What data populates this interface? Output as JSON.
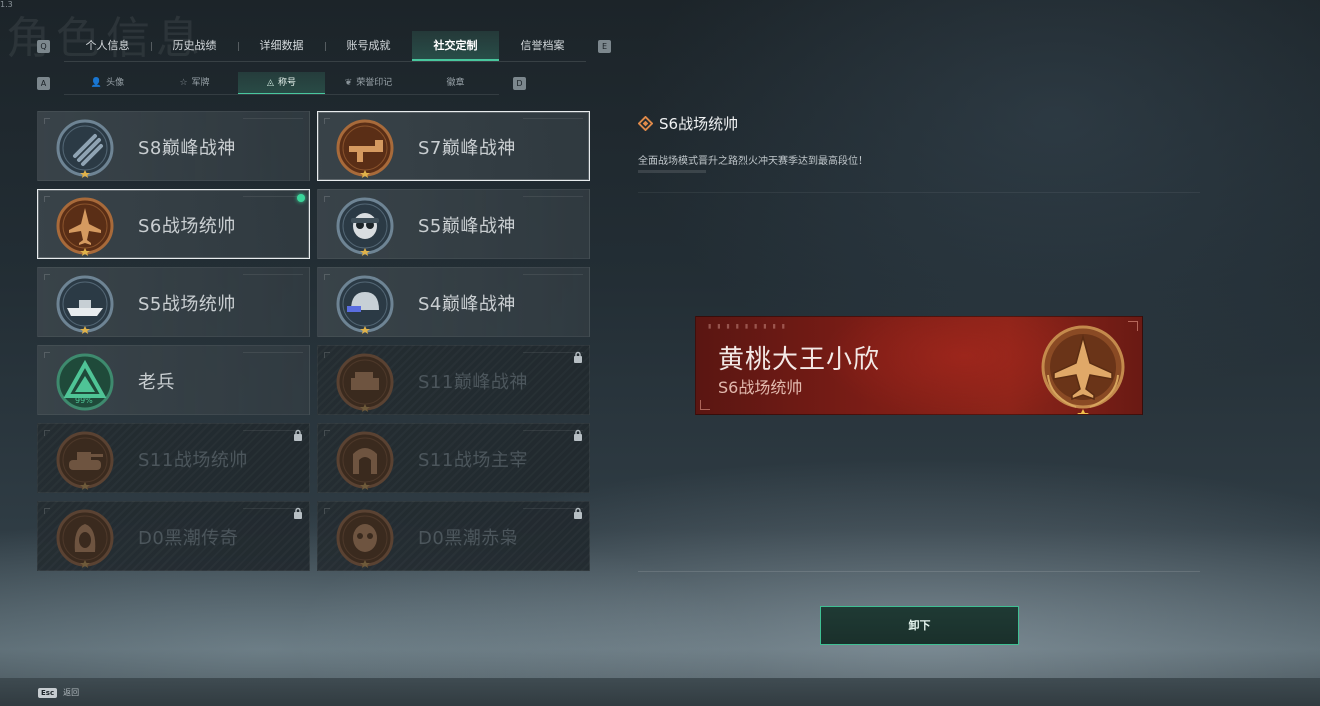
{
  "page": {
    "ghost_title": "角色信息",
    "version": "1.3"
  },
  "top_tabs": {
    "left_key": "Q",
    "right_key": "E",
    "items": [
      {
        "label": "个人信息",
        "active": false
      },
      {
        "label": "历史战绩",
        "active": false
      },
      {
        "label": "详细数据",
        "active": false
      },
      {
        "label": "账号成就",
        "active": false
      },
      {
        "label": "社交定制",
        "active": true
      },
      {
        "label": "信誉档案",
        "active": false
      }
    ]
  },
  "sub_tabs": {
    "left_key": "A",
    "right_key": "D",
    "items": [
      {
        "label": "头像",
        "icon": "person-icon",
        "glyph": "👤",
        "active": false
      },
      {
        "label": "军牌",
        "icon": "dogtag-icon",
        "glyph": "☆",
        "active": false
      },
      {
        "label": "称号",
        "icon": "rank-icon",
        "glyph": "◬",
        "active": true
      },
      {
        "label": "荣誉印记",
        "icon": "laurel-icon",
        "glyph": "❦",
        "active": false
      },
      {
        "label": "徽章",
        "icon": "badge-icon",
        "glyph": "",
        "active": false
      }
    ]
  },
  "titles": [
    {
      "name": "S8巅峰战神",
      "locked": false,
      "selected": false,
      "equipped": false,
      "emblem": "cross-emblem-icon",
      "tone": "silver"
    },
    {
      "name": "S7巅峰战神",
      "locked": false,
      "selected": true,
      "equipped": false,
      "emblem": "rifle-emblem-icon",
      "tone": "bronze"
    },
    {
      "name": "S6战场统帅",
      "locked": false,
      "selected": true,
      "equipped": true,
      "emblem": "jet-emblem-icon",
      "tone": "bronze"
    },
    {
      "name": "S5巅峰战神",
      "locked": false,
      "selected": false,
      "equipped": false,
      "emblem": "skull-emblem-icon",
      "tone": "silver"
    },
    {
      "name": "S5战场统帅",
      "locked": false,
      "selected": false,
      "equipped": false,
      "emblem": "boat-emblem-icon",
      "tone": "silver"
    },
    {
      "name": "S4巅峰战神",
      "locked": false,
      "selected": false,
      "equipped": false,
      "emblem": "helmet-emblem-icon",
      "tone": "silver"
    },
    {
      "name": "老兵",
      "locked": false,
      "selected": false,
      "equipped": false,
      "emblem": "veteran-emblem-icon",
      "tone": "green",
      "progress_label": "99%"
    },
    {
      "name": "S11巅峰战神",
      "locked": true,
      "selected": false,
      "equipped": false,
      "emblem": "vehicle-emblem-icon",
      "tone": "dim"
    },
    {
      "name": "S11战场统帅",
      "locked": true,
      "selected": false,
      "equipped": false,
      "emblem": "tank-emblem-icon",
      "tone": "dim"
    },
    {
      "name": "S11战场主宰",
      "locked": true,
      "selected": false,
      "equipped": false,
      "emblem": "arch-emblem-icon",
      "tone": "dim"
    },
    {
      "name": "D0黑潮传奇",
      "locked": true,
      "selected": false,
      "equipped": false,
      "emblem": "hooded-emblem-icon",
      "tone": "dim"
    },
    {
      "name": "D0黑潮赤枭",
      "locked": true,
      "selected": false,
      "equipped": false,
      "emblem": "mask-emblem-icon",
      "tone": "dim"
    }
  ],
  "detail": {
    "title": "S6战场统帅",
    "description": "全面战场模式晋升之路烈火冲天赛季达到最高段位！"
  },
  "nameplate": {
    "player_name": "黄桃大王小欣",
    "title": "S6战场统帅"
  },
  "actions": {
    "unequip_label": "卸下"
  },
  "footer": {
    "esc_key": "Esc",
    "esc_label": "返回"
  },
  "colors": {
    "accent": "#49c79e",
    "bronze": "#a86a3a",
    "silver": "#8fa3b3",
    "plate_red": "#7c1d16"
  }
}
